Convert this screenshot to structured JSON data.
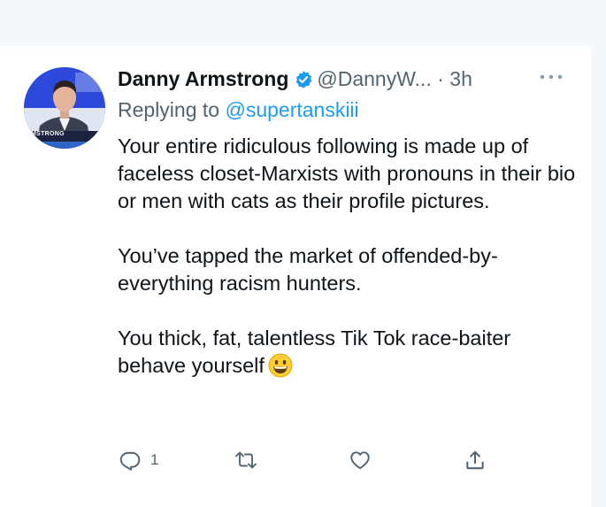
{
  "tweet": {
    "author_name": "Danny Armstrong",
    "author_handle": "@DannyW...",
    "separator": "·",
    "time": "3h",
    "replying_prefix": "Replying to",
    "replying_to": "@supertanskiii",
    "paragraphs": [
      "Your entire ridiculous following is made up of faceless closet-Marxists with pronouns in their bio or men with cats as their profile pictures.",
      "You’ve tapped the market of offended-by-everything racism hunters.",
      "You thick, fat, talentless Tik Tok race-baiter behave yourself"
    ],
    "avatar_caption": "MSTRONG",
    "emoji": "grinning-face-icon"
  },
  "actions": {
    "reply_count": "1",
    "icons": [
      "reply-icon",
      "retweet-icon",
      "like-icon",
      "share-icon"
    ]
  },
  "colors": {
    "link": "#1d9bf0",
    "secondary_text": "#536471",
    "primary_text": "#0f1419",
    "verified_badge": "#1d9bf0"
  }
}
